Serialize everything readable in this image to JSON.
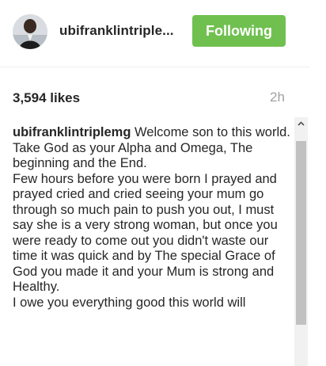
{
  "header": {
    "username": "ubifranklintriple...",
    "follow_label": "Following",
    "follow_color": "#70c050"
  },
  "stats": {
    "likes": "3,594 likes",
    "time_ago": "2h"
  },
  "caption": {
    "username": "ubifranklintriplemg",
    "text": " Welcome son to this world.\nTake God as your Alpha and Omega, The beginning and the End.\nFew hours before you were born I prayed and prayed cried and cried seeing your mum go through so much pain to push you out, I must say she is a very strong woman, but once you were ready to come out you didn't waste our time it was quick and by The special Grace of God you made it and your Mum is strong and Healthy.\nI owe you everything good this world will"
  },
  "icons": {
    "avatar": "profile-photo",
    "scroll_up": "chevron-up-icon"
  }
}
